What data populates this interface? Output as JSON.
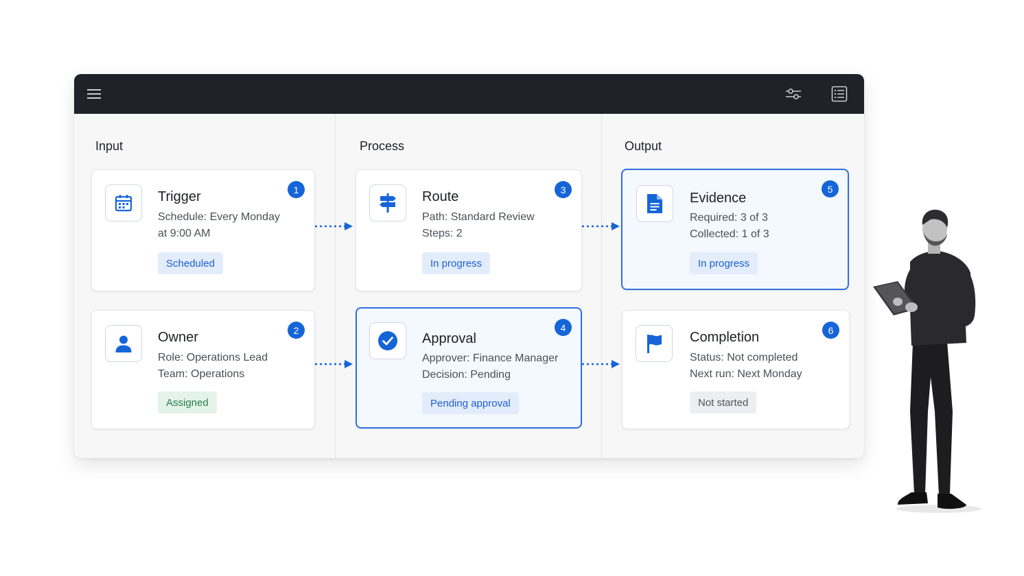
{
  "toolbar": {
    "menu_icon": "menu-icon",
    "filter_icon": "sliders-icon",
    "list_icon": "list-view-icon"
  },
  "columns": {
    "input": "Input",
    "process": "Process",
    "output": "Output"
  },
  "cards": {
    "trigger": {
      "number": "1",
      "icon": "calendar-icon",
      "title": "Trigger",
      "line1": "Schedule: Every Monday",
      "line2": "at 9:00 AM",
      "chip": "Scheduled"
    },
    "owner": {
      "number": "2",
      "icon": "user-icon",
      "title": "Owner",
      "line1": "Role: Operations Lead",
      "line2": "Team: Operations",
      "chip": "Assigned"
    },
    "route": {
      "number": "3",
      "icon": "signpost-icon",
      "title": "Route",
      "line1": "Path: Standard Review",
      "line2": "Steps: 2",
      "chip": "In progress"
    },
    "approval": {
      "number": "4",
      "icon": "check-circle-icon",
      "title": "Approval",
      "line1": "Approver: Finance Manager",
      "line2": "Decision: Pending",
      "chip": "Pending approval"
    },
    "evidence": {
      "number": "5",
      "icon": "document-icon",
      "title": "Evidence",
      "line1": "Required: 3 of 3",
      "line2": "Collected: 1 of 3",
      "chip": "In progress"
    },
    "completion": {
      "number": "6",
      "icon": "flag-icon",
      "title": "Completion",
      "line1": "Status: Not completed",
      "line2": "Next run: Next Monday",
      "chip": "Not started"
    }
  },
  "colors": {
    "accent": "#1565d8",
    "topbar": "#1f2229",
    "selected_border": "#2f6fdd",
    "chip_blue_bg": "#e3ecfb",
    "chip_green_bg": "#e4f3e9",
    "chip_gray_bg": "#eceef1"
  }
}
